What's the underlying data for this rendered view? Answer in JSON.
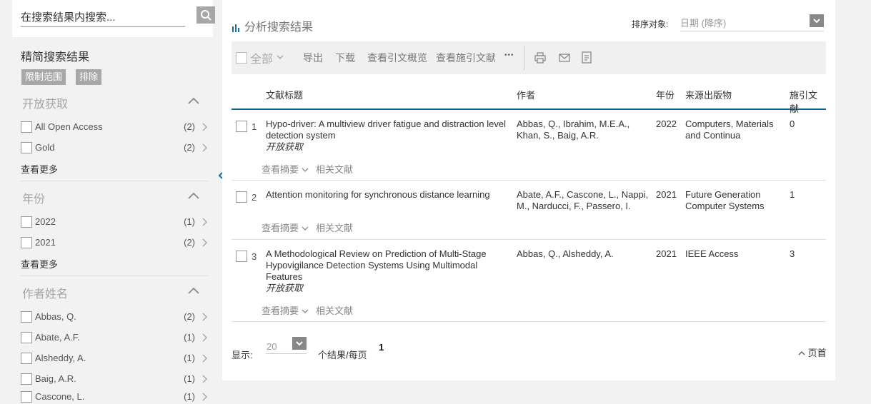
{
  "search": {
    "placeholder": "在搜索结果内搜索..."
  },
  "refine": {
    "title": "精简搜索结果",
    "limit_label": "限制范围",
    "exclude_label": "排除",
    "see_more": "查看更多",
    "facets": [
      {
        "title": "开放获取",
        "items": [
          {
            "label": "All Open Access",
            "count": "(2)"
          },
          {
            "label": "Gold",
            "count": "(2)"
          }
        ]
      },
      {
        "title": "年份",
        "items": [
          {
            "label": "2022",
            "count": "(1)"
          },
          {
            "label": "2021",
            "count": "(2)"
          }
        ]
      },
      {
        "title": "作者姓名",
        "items": [
          {
            "label": "Abbas, Q.",
            "count": "(2)"
          },
          {
            "label": "Abate, A.F.",
            "count": "(1)"
          },
          {
            "label": "Alsheddy, A.",
            "count": "(1)"
          },
          {
            "label": "Baig, A.R.",
            "count": "(1)"
          },
          {
            "label": "Cascone, L.",
            "count": "(1)"
          }
        ]
      }
    ]
  },
  "main": {
    "analyze_label": "分析搜索结果",
    "sort_label": "排序对象:",
    "sort_value": "日期 (降序)",
    "toolbar": {
      "select_all": "全部",
      "export": "导出",
      "download": "下载",
      "citation_overview": "查看引文概览",
      "cited_by": "查看施引文献",
      "more": "•••"
    },
    "columns": {
      "title": "文献标题",
      "authors": "作者",
      "year": "年份",
      "source": "来源出版物",
      "cited": "施引文献"
    },
    "abstract_label": "查看摘要",
    "related_label": "相关文献",
    "open_access_label": "开放获取",
    "rows": [
      {
        "num": "1",
        "title": "Hypo-driver: A multiview driver fatigue and distraction level detection system",
        "authors": "Abbas, Q., Ibrahim, M.E.A., Khan, S., Baig, A.R.",
        "year": "2022",
        "source": "Computers, Materials and Continua",
        "cited": "0"
      },
      {
        "num": "2",
        "title": "Attention monitoring for synchronous distance learning",
        "authors": "Abate, A.F., Cascone, L., Nappi, M., Narducci, F., Passero, I.",
        "year": "2021",
        "source": "Future Generation Computer Systems",
        "cited": "1"
      },
      {
        "num": "3",
        "title": "A Methodological Review on Prediction of Multi-Stage Hypovigilance Detection Systems Using Multimodal Features",
        "authors": "Abbas, Q., Alsheddy, A.",
        "year": "2021",
        "source": "IEEE Access",
        "cited": "3"
      }
    ],
    "footer": {
      "show_label": "显示:",
      "per_page_value": "20",
      "per_page_text": "个结果/每页",
      "page": "1",
      "top_label": "页首"
    }
  }
}
